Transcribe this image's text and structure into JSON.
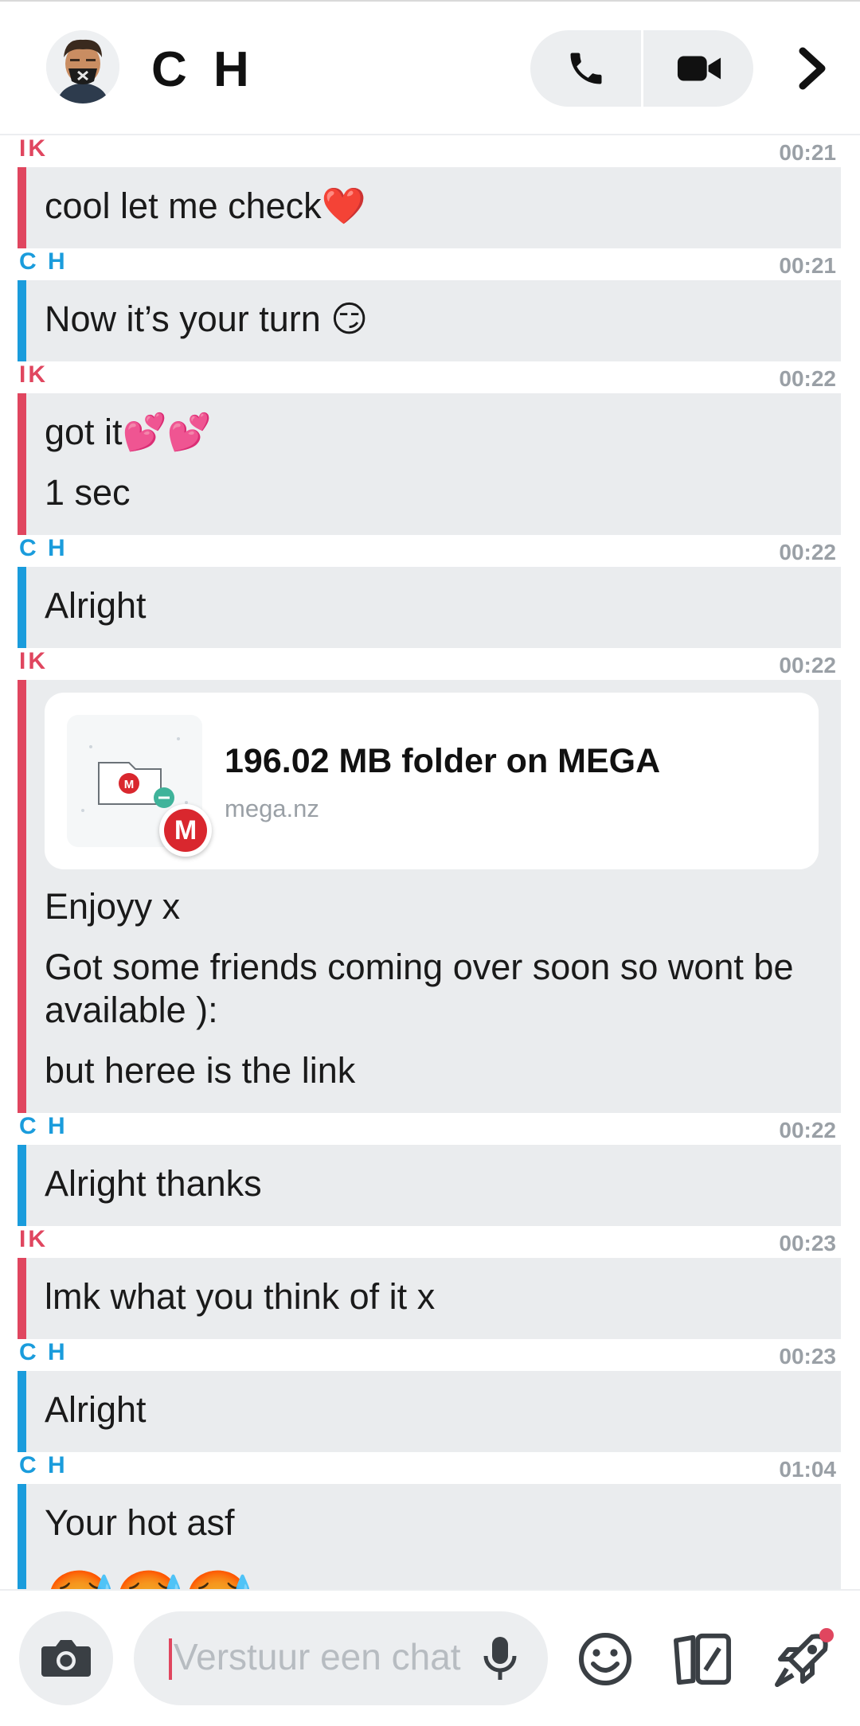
{
  "header": {
    "title": "C H",
    "avatar_icon": "bitmoji-avatar-icon",
    "call_icon": "phone-icon",
    "video_icon": "video-camera-icon",
    "more_icon": "chevron-right-icon"
  },
  "colors": {
    "me": "#e0465f",
    "friend": "#1a9cdc",
    "bubble_bg": "#eaecee"
  },
  "messages": [
    {
      "sender": "IK",
      "time": "00:21",
      "lines": [
        "cool let me check❤️"
      ]
    },
    {
      "sender": "C H",
      "time": "00:21",
      "lines": [
        "Now it’s your turn 😏"
      ]
    },
    {
      "sender": "IK",
      "time": "00:22",
      "lines": [
        "got it💕💕",
        "1 sec"
      ]
    },
    {
      "sender": "C H",
      "time": "00:22",
      "lines": [
        "Alright"
      ]
    },
    {
      "sender": "IK",
      "time": "00:22",
      "card": {
        "title": "196.02 MB folder on MEGA",
        "domain": "mega.nz",
        "badge": "M"
      },
      "lines": [
        "Enjoyy x",
        "Got some friends coming over soon so wont be available ):",
        "but heree is the link"
      ]
    },
    {
      "sender": "C H",
      "time": "00:22",
      "lines": [
        "Alright thanks"
      ]
    },
    {
      "sender": "IK",
      "time": "00:23",
      "lines": [
        "lmk what you think of it x"
      ]
    },
    {
      "sender": "C H",
      "time": "00:23",
      "lines": [
        "Alright"
      ]
    },
    {
      "sender": "C H",
      "time": "01:04",
      "lines": [
        "Your hot asf",
        "🥵🥵🥵"
      ]
    }
  ],
  "composer": {
    "placeholder": "Verstuur een chat",
    "camera_icon": "camera-icon",
    "mic_icon": "microphone-icon",
    "emoji_icon": "smiley-icon",
    "stickers_icon": "cards-icon",
    "games_icon": "rocket-icon"
  }
}
